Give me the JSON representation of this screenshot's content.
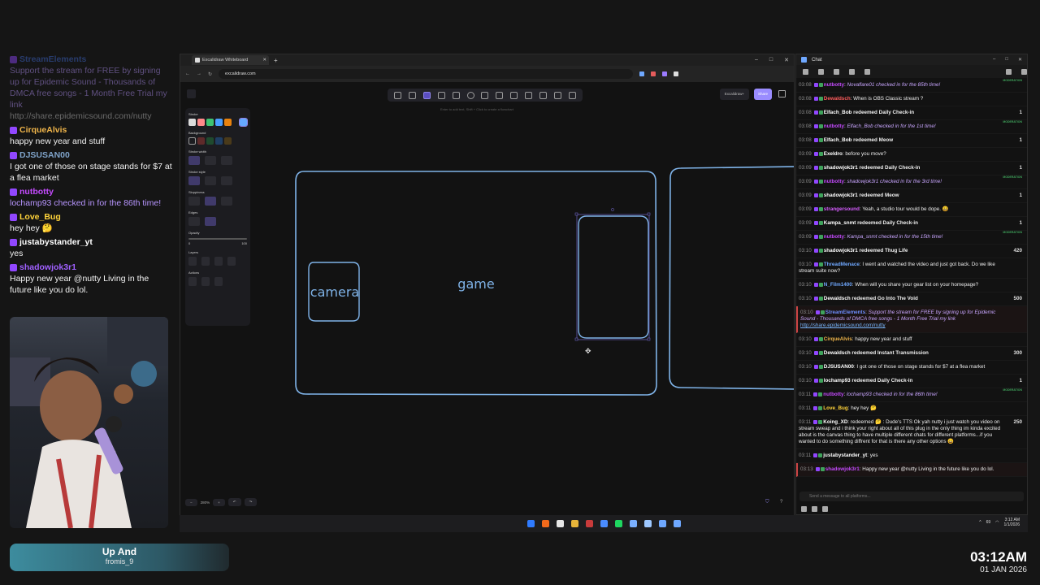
{
  "overlay_chat": [
    {
      "user": "StreamElements",
      "color": "#3f6bd6",
      "text": "Support the stream for FREE by signing up for Epidemic Sound - Thousands of DMCA free songs - 1 Month Free Trial my link",
      "link": "http://share.epidemicsound.com/nutty",
      "fade": true,
      "ital": true
    },
    {
      "user": "CirqueAlvis",
      "color": "#f0b54a",
      "text": "happy new year and stuff"
    },
    {
      "user": "DJSUSAN00",
      "color": "#7fa3c9",
      "text": "I got one of those on stage stands for $7 at a flea market"
    },
    {
      "user": "nutbotty",
      "color": "#c54bff",
      "text": "lochamp93 checked in for the 86th time!",
      "ital": true
    },
    {
      "user": "Love_Bug",
      "color": "#ffd33a",
      "text": "hey hey 🤔"
    },
    {
      "user": "justabystander_yt",
      "color": "#ffffff",
      "text": "yes"
    },
    {
      "user": "shadowjok3r1",
      "color": "#a060ff",
      "text": "Happy new year @nutty Living in the future like you do lol."
    }
  ],
  "now_playing": {
    "title": "Up And",
    "artist": "fromis_9"
  },
  "clock": {
    "time": "03:12AM",
    "date": "01 JAN 2026"
  },
  "browser": {
    "tab_title": "Excalidraw Whiteboard",
    "url": "excalidraw.com",
    "library_label": "Excalidraw+",
    "share_label": "Share",
    "hint": "Enter to add text, Shift + Click to create a flowchart",
    "zoom": "280%"
  },
  "props_panel": {
    "stroke": "Stroke",
    "background": "Background",
    "stroke_width": "Stroke width",
    "stroke_style": "Stroke style",
    "sloppiness": "Sloppiness",
    "edges": "Edges",
    "opacity": "Opacity",
    "opacity_min": "0",
    "opacity_max": "100",
    "layers": "Layers",
    "actions": "Actions",
    "stroke_colors": [
      "#dcdcdc",
      "#ff8a8a",
      "#3ec271",
      "#4a9eff",
      "#e8820e",
      "#66aaff"
    ]
  },
  "drawing": {
    "label_camera": "camera",
    "label_game": "game",
    "stroke_color": "#7fb3e8"
  },
  "chat": {
    "title": "Chat",
    "input_placeholder": "Send a message to all platforms...",
    "messages": [
      {
        "ts": "03:08",
        "user": "nutbotty",
        "ucolor": "#c54bff",
        "text": "justabystander_yt checked in for the 16th time!",
        "italic": true,
        "mod": "MODERATION"
      },
      {
        "ts": "03:08",
        "user": "Novaflare01",
        "ucolor": "#ffffff",
        "text": "redeemed Daily Check-in",
        "bold_text": true,
        "pts": "1"
      },
      {
        "ts": "03:08",
        "user": "nutbotty",
        "ucolor": "#c54bff",
        "text": "Novaflare01 checked in for the 85th time!",
        "italic": true,
        "mod": "MODERATION"
      },
      {
        "ts": "03:08",
        "user": "Dewaldsch",
        "ucolor": "#ff5d5d",
        "text": "When is OBS Classic stream ?"
      },
      {
        "ts": "03:08",
        "user": "Elfach_Bob",
        "ucolor": "#ffffff",
        "text": "redeemed Daily Check-in",
        "bold_text": true,
        "pts": "1"
      },
      {
        "ts": "03:08",
        "user": "nutbotty",
        "ucolor": "#c54bff",
        "text": "Elfach_Bob checked in for the 1st time!",
        "italic": true,
        "mod": "MODERATION"
      },
      {
        "ts": "03:08",
        "user": "Elfach_Bob",
        "ucolor": "#ffffff",
        "text": "redeemed Meow",
        "bold_text": true,
        "pts": "1"
      },
      {
        "ts": "03:09",
        "user": "Exeldro",
        "ucolor": "#ffffff",
        "text": "before you move?"
      },
      {
        "ts": "03:09",
        "user": "shadowjok3r1",
        "ucolor": "#ffffff",
        "text": "redeemed Daily Check-in",
        "bold_text": true,
        "pts": "1"
      },
      {
        "ts": "03:09",
        "user": "nutbotty",
        "ucolor": "#c54bff",
        "text": "shadowjok3r1 checked in for the 3rd time!",
        "italic": true,
        "mod": "MODERATION"
      },
      {
        "ts": "03:09",
        "user": "shadowjok3r1",
        "ucolor": "#ffffff",
        "text": "redeemed Meow",
        "bold_text": true,
        "pts": "1"
      },
      {
        "ts": "03:09",
        "user": "strangersound",
        "ucolor": "#d65dff",
        "text": "Yeah, a studio tour would be dope. 😀"
      },
      {
        "ts": "03:09",
        "user": "Kampa_snmt",
        "ucolor": "#ffffff",
        "text": "redeemed Daily Check-in",
        "bold_text": true,
        "pts": "1"
      },
      {
        "ts": "03:09",
        "user": "nutbotty",
        "ucolor": "#c54bff",
        "text": "Kampa_snmt checked in for the 15th time!",
        "italic": true,
        "mod": "MODERATION"
      },
      {
        "ts": "03:10",
        "user": "shadowjok3r1",
        "ucolor": "#ffffff",
        "text": "redeemed Thug Life",
        "bold_text": true,
        "pts": "420"
      },
      {
        "ts": "03:10",
        "user": "ThreadMenace",
        "ucolor": "#6fa8ff",
        "text": "I went and watched the video and just got back. Do we like stream suite now?"
      },
      {
        "ts": "03:10",
        "user": "N_Film1400",
        "ucolor": "#6fa8ff",
        "text": "When will you share your gear list on your homepage?"
      },
      {
        "ts": "03:10",
        "user": "Dewaldsch",
        "ucolor": "#ffffff",
        "text": "redeemed Go Into The Void",
        "bold_text": true,
        "pts": "500"
      },
      {
        "ts": "03:10",
        "user": "StreamElements",
        "ucolor": "#6f8fff",
        "text": "Support the stream for FREE by signing up for Epidemic Sound - Thousands of DMCA free songs - 1 Month Free Trial my link",
        "italic": true,
        "link": "http://share.epidemicsound.com/nutty",
        "hl": true
      },
      {
        "ts": "03:10",
        "user": "CirqueAlvis",
        "ucolor": "#f0b54a",
        "text": "happy new year and stuff"
      },
      {
        "ts": "03:10",
        "user": "Dewaldsch",
        "ucolor": "#ffffff",
        "text": "redeemed Instant Transmission",
        "bold_text": true,
        "pts": "300"
      },
      {
        "ts": "03:10",
        "user": "DJSUSAN00",
        "ucolor": "#ffffff",
        "text": "I got one of those on stage stands for $7 at a flea market"
      },
      {
        "ts": "03:10",
        "user": "lochamp93",
        "ucolor": "#ffffff",
        "text": "redeemed Daily Check-in",
        "bold_text": true,
        "pts": "1"
      },
      {
        "ts": "03:11",
        "user": "nutbotty",
        "ucolor": "#c54bff",
        "text": "lochamp93 checked in for the 86th time!",
        "italic": true,
        "mod": "MODERATION"
      },
      {
        "ts": "03:11",
        "user": "Love_Bug",
        "ucolor": "#ffd33a",
        "text": "hey hey 🤔"
      },
      {
        "ts": "03:11",
        "user": "Koing_XD",
        "ucolor": "#ffffff",
        "text": "redeemed 🤔 : Dude's TTS Ok yah nutty i just watch you video on stream sweap and i think your right about all of this plug in the only thing im kinda excited about is the canvas thing to have multiple different chats for different platforms...if you wanted to do something diffrent for that is there any other options 😀",
        "pts": "250"
      },
      {
        "ts": "03:11",
        "user": "justabystander_yt",
        "ucolor": "#ffffff",
        "text": "yes"
      },
      {
        "ts": "03:13",
        "user": "shadowjok3r1",
        "ucolor": "#c54bff",
        "text": "Happy new year @nutty Living in the future like you do lol.",
        "hl": true
      }
    ]
  },
  "taskbar": {
    "tray_time": "3:12 AM",
    "tray_date": "1/1/2026",
    "tray_vol": "69",
    "icon_colors": [
      "#2f7bff",
      "#f26a1b",
      "#e6e6e6",
      "#e7b43a",
      "#c83b3b",
      "#4a8cff",
      "#1ed760",
      "#7ab0ff",
      "#9ec8ff",
      "#6fa8ff",
      "#6fa8ff"
    ]
  }
}
